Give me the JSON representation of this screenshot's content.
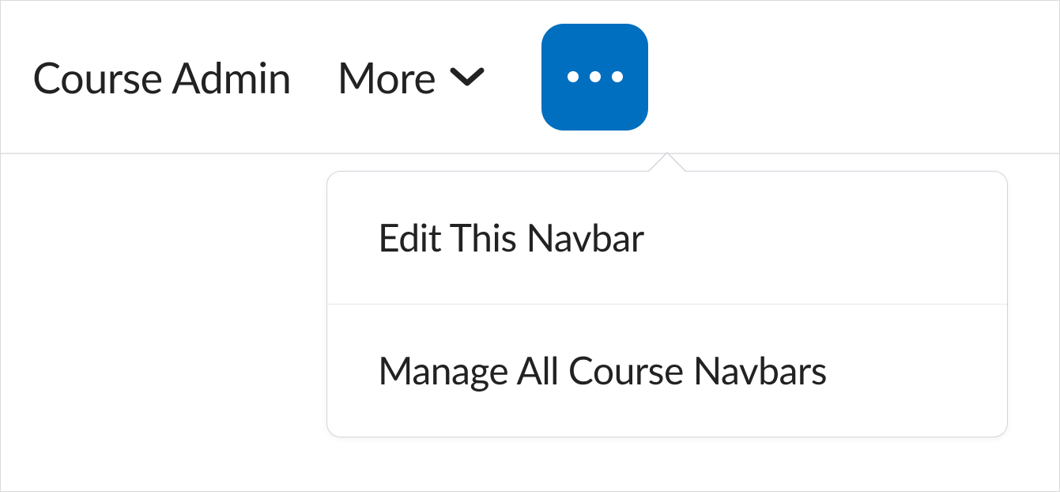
{
  "navbar": {
    "items": [
      {
        "label": "Course Admin"
      },
      {
        "label": "More"
      }
    ]
  },
  "dropdown": {
    "items": [
      {
        "label": "Edit This Navbar"
      },
      {
        "label": "Manage All Course Navbars"
      }
    ]
  },
  "colors": {
    "accent": "#006fbf"
  }
}
